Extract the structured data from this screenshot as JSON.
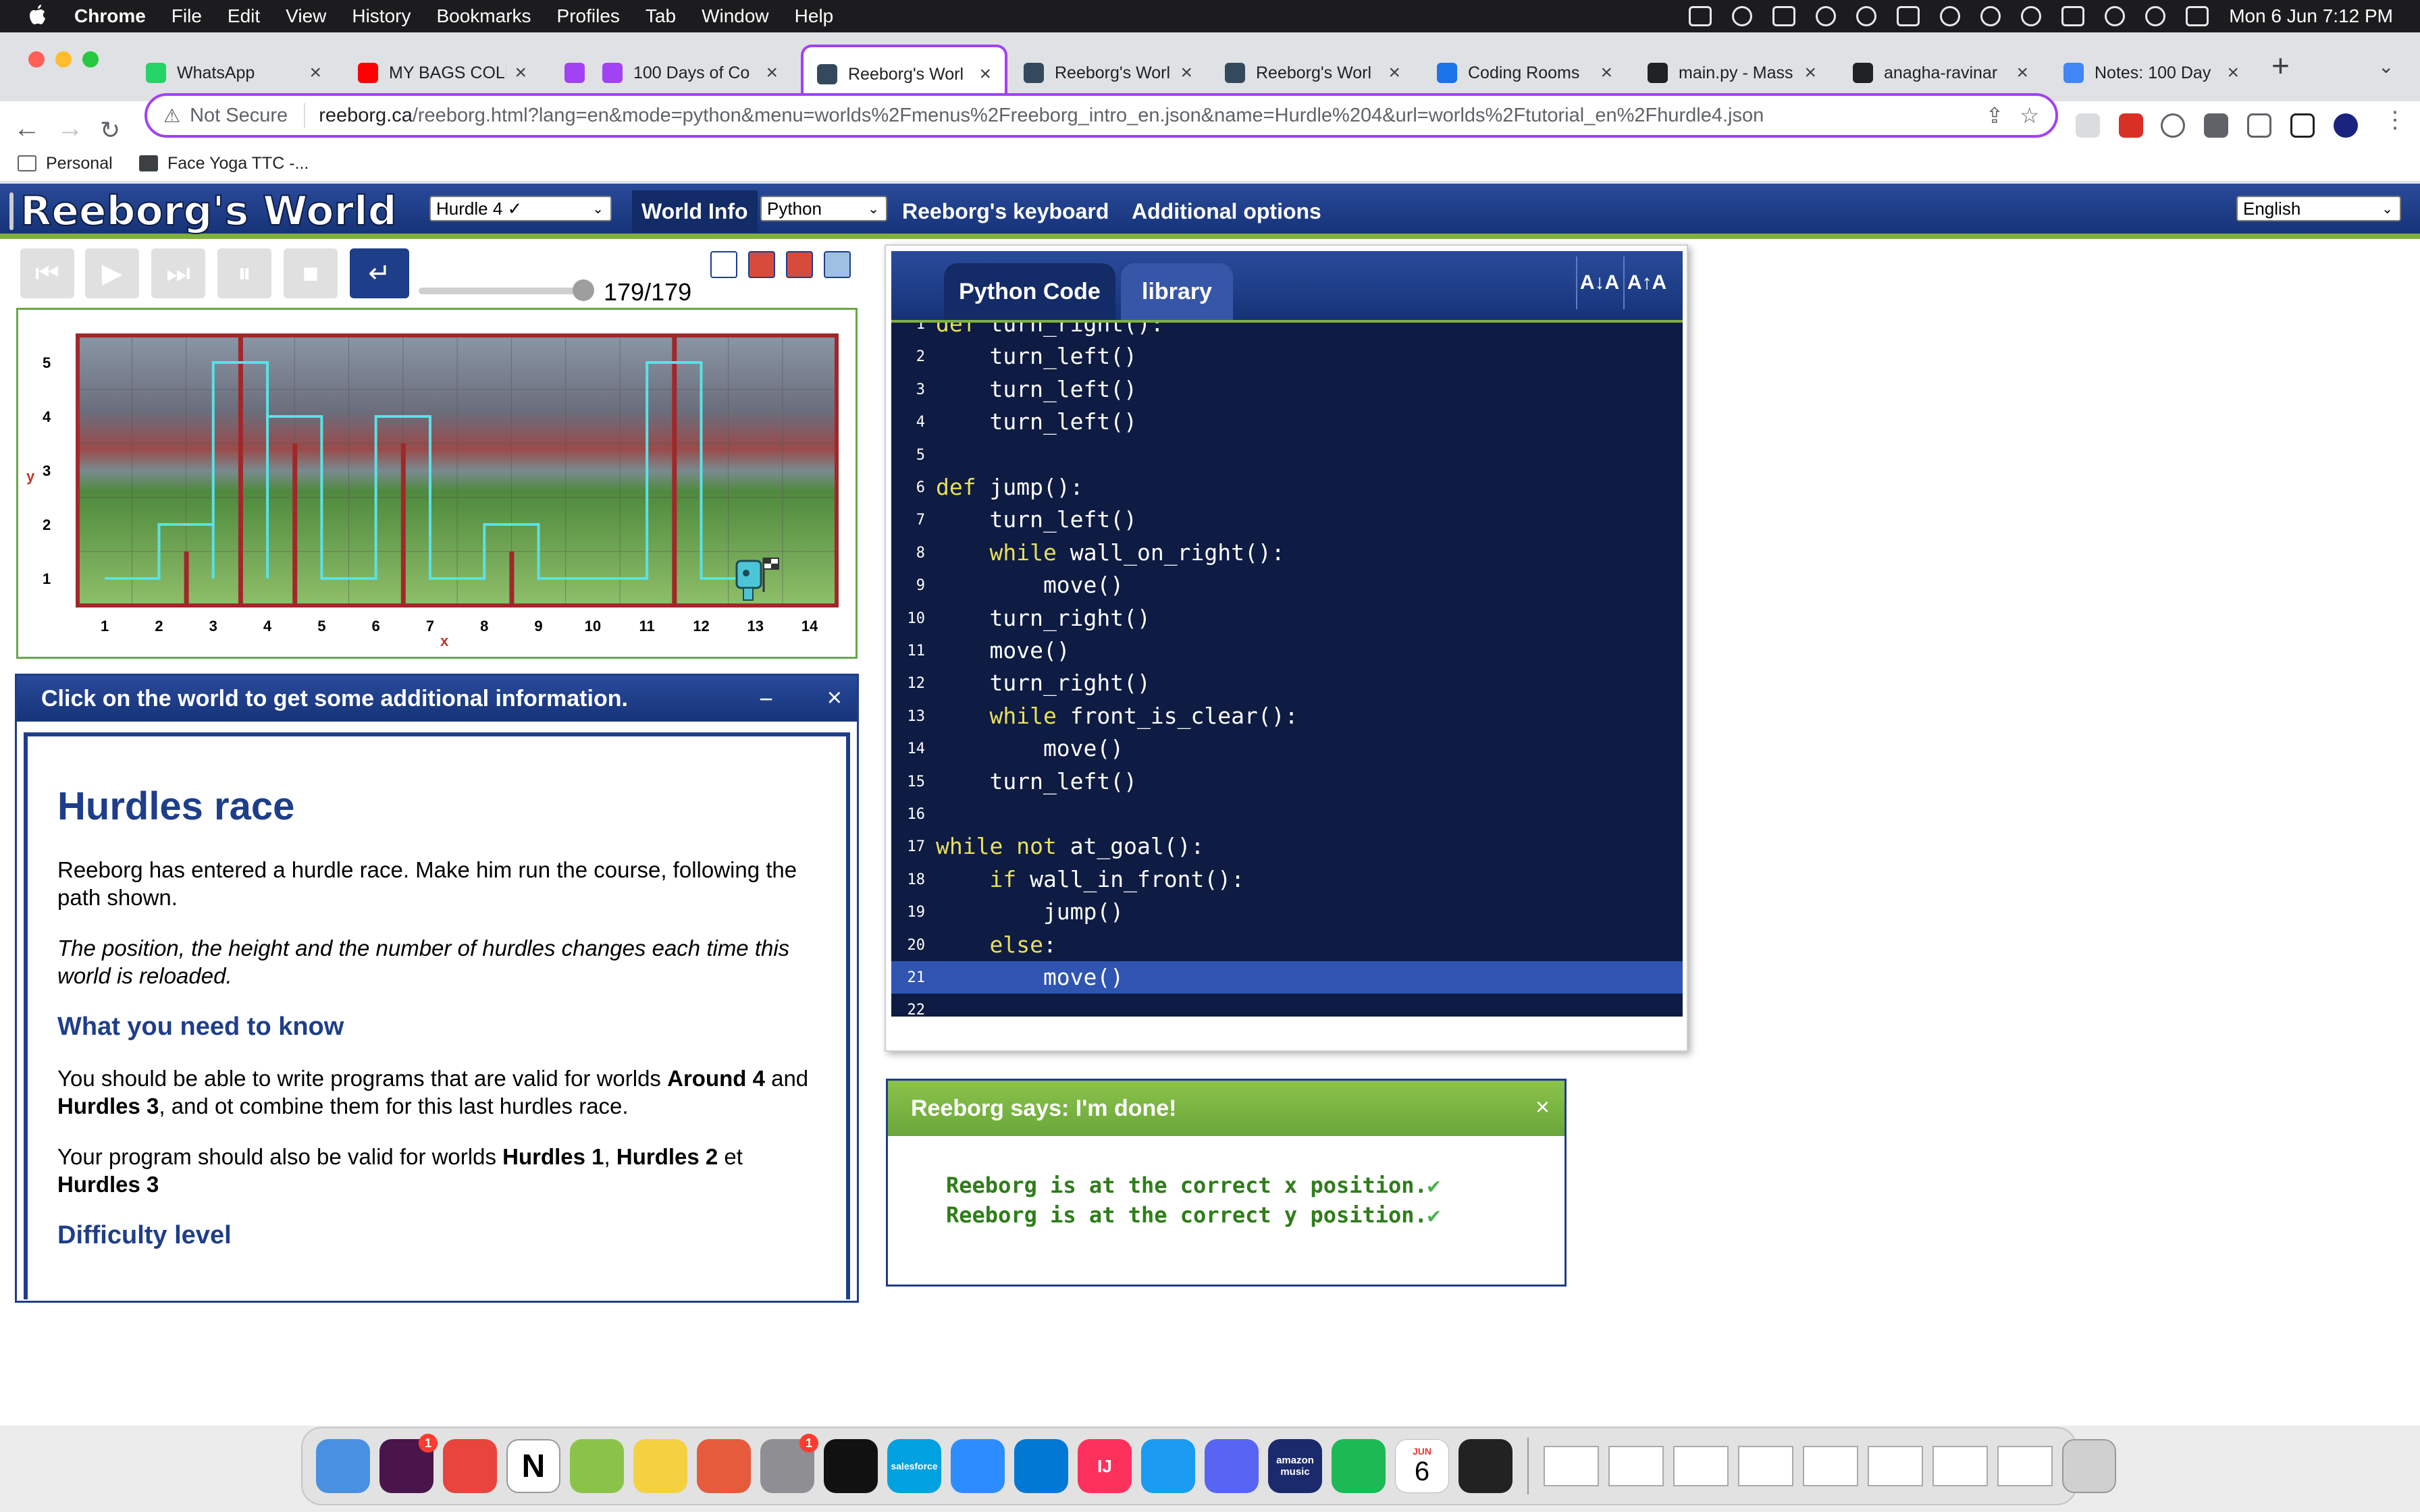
{
  "menubar": {
    "app": "Chrome",
    "items": [
      "File",
      "Edit",
      "View",
      "History",
      "Bookmarks",
      "Profiles",
      "Tab",
      "Window",
      "Help"
    ],
    "clock": "Mon 6 Jun  7:12 PM"
  },
  "tabs": [
    {
      "title": "WhatsApp",
      "color": "#25d366"
    },
    {
      "title": "MY BAGS COLL",
      "color": "#ff0000"
    },
    {
      "title": "",
      "color": "#a142f4"
    },
    {
      "title": "100 Days of Co",
      "color": "#a142f4"
    },
    {
      "title": "Reeborg's Worl",
      "color": "#34495e"
    },
    {
      "title": "Reeborg's Worl",
      "color": "#34495e"
    },
    {
      "title": "Reeborg's Worl",
      "color": "#34495e"
    },
    {
      "title": "Coding Rooms",
      "color": "#1a73e8"
    },
    {
      "title": "main.py - Mass",
      "color": "#202124"
    },
    {
      "title": "anagha-ravinar",
      "color": "#202124"
    },
    {
      "title": "Notes: 100 Day",
      "color": "#4285f4"
    }
  ],
  "address": {
    "security": "Not Secure",
    "url_domain": "reeborg.ca",
    "url_path": "/reeborg.html?lang=en&mode=python&menu=worlds%2Fmenus%2Freeborg_intro_en.json&name=Hurdle%204&url=worlds%2Ftutorial_en%2Fhurdle4.json"
  },
  "bookmarks": [
    "Personal",
    "Face Yoga TTC -..."
  ],
  "header": {
    "logo": "Reeborg's World",
    "world_select": "Hurdle 4 ✓ ",
    "world_info": "World Info",
    "language_select": "Python",
    "keyboard": "Reeborg's keyboard",
    "additional": "Additional options",
    "ui_language": "English"
  },
  "controls": {
    "step_counter": "179/179",
    "speed_percent": 100
  },
  "world": {
    "y_label": "y",
    "x_label": "x",
    "x_ticks": [
      "1",
      "2",
      "3",
      "4",
      "5",
      "6",
      "7",
      "8",
      "9",
      "10",
      "11",
      "12",
      "13",
      "14"
    ],
    "y_ticks": [
      "5",
      "4",
      "3",
      "2",
      "1"
    ]
  },
  "info": {
    "header": "Click on the world to get some additional information.",
    "minimize": "−",
    "close": "×",
    "title": "Hurdles race",
    "p1": "Reeborg has entered a hurdle race. Make him run the course, following the path shown.",
    "p2": "The position, the height and the number of hurdles changes each time this world is reloaded.",
    "h_know": "What you need to know",
    "p3_a": "You should be able to write programs that are valid for worlds ",
    "p3_b": "Around 4",
    "p3_c": " and ",
    "p3_d": "Hurdles 3",
    "p3_e": ", and ot combine them for this last hurdles race.",
    "p4_a": "Your program should also be valid for worlds ",
    "p4_b": "Hurdles 1",
    "p4_c": ", ",
    "p4_d": "Hurdles 2",
    "p4_e": " et ",
    "p4_f": "Hurdles 3",
    "h_diff": "Difficulty level"
  },
  "editor": {
    "tab_code": "Python Code",
    "tab_library": "library",
    "font_down": "A↓A",
    "font_up": "A↑A",
    "highlight_line": 21,
    "lines": [
      "def turn_right():",
      "    turn_left()",
      "    turn_left()",
      "    turn_left()",
      "",
      "def jump():",
      "    turn_left()",
      "    while wall_on_right():",
      "        move()",
      "    turn_right()",
      "    move()",
      "    turn_right()",
      "    while front_is_clear():",
      "        move()",
      "    turn_left()",
      "",
      "while not at_goal():",
      "    if wall_in_front():",
      "        jump()",
      "    else:",
      "        move()",
      ""
    ]
  },
  "output": {
    "header": "Reeborg says: I'm done!",
    "close": "×",
    "line1": "Reeborg is at the correct x position.",
    "line2": "Reeborg is at the correct y position.",
    "check": "✔"
  },
  "dock": [
    {
      "name": "finder",
      "color": "#4a90e2"
    },
    {
      "name": "slack",
      "color": "#4a154b"
    },
    {
      "name": "chrome",
      "color": "#e8453c"
    },
    {
      "name": "notion",
      "color": "#ffffff"
    },
    {
      "name": "keychain",
      "color": "#8bc34a"
    },
    {
      "name": "notes",
      "color": "#f5d142"
    },
    {
      "name": "speedify",
      "color": "#e55b3c"
    },
    {
      "name": "system-preferences",
      "color": "#8e8e93"
    },
    {
      "name": "terminal",
      "color": "#111111"
    },
    {
      "name": "salesforce",
      "color": "#00a1e0"
    },
    {
      "name": "zoom",
      "color": "#2d8cff"
    },
    {
      "name": "vscode",
      "color": "#0078d4"
    },
    {
      "name": "intellij",
      "color": "#fe315d"
    },
    {
      "name": "keynote",
      "color": "#1a9bf0"
    },
    {
      "name": "discord",
      "color": "#5865f2"
    },
    {
      "name": "amazon-music",
      "color": "#1a2a6c"
    },
    {
      "name": "spotify",
      "color": "#1db954"
    },
    {
      "name": "calendar",
      "color": "#ffffff"
    },
    {
      "name": "activity-monitor",
      "color": "#222222"
    }
  ],
  "dock_labels": {
    "salesforce": "salesforce",
    "amazon_music": "amazon music",
    "calendar_month": "JUN",
    "calendar_day": "6",
    "slack_badge": "1",
    "prefs_badge": "1",
    "intellij": "IJ"
  }
}
